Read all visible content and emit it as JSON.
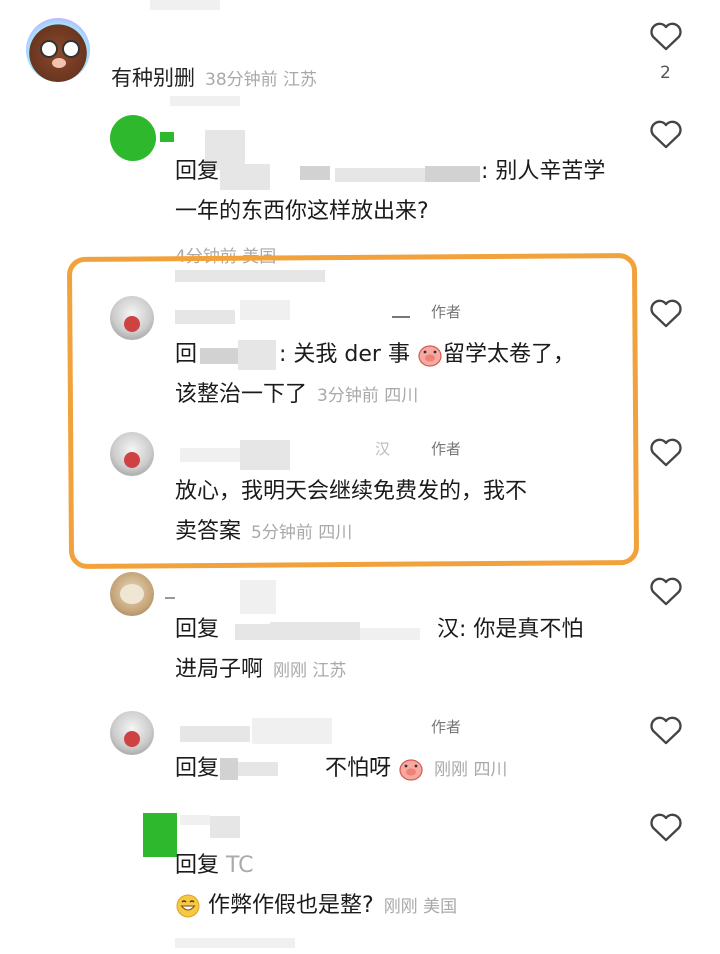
{
  "comments": [
    {
      "name": "有种别删",
      "time": "38分钟前",
      "loc": "江苏",
      "likes": "2"
    },
    {
      "reply_prefix": "回复",
      "line1": ": 别人辛苦学",
      "line2": "一年的东西你这样放出来?",
      "time": "4分钟前",
      "loc": "美国"
    },
    {
      "author_tag": "作者",
      "reply_prefix": "回",
      "line1": ": 关我 der 事",
      "line1b": "留学太卷了，",
      "line2": "该整治一下了",
      "time": "3分钟前",
      "loc": "四川"
    },
    {
      "author_tag": "作者",
      "line1": "放心，我明天会继续免费发的，我不",
      "line2": "卖答案",
      "time": "5分钟前",
      "loc": "四川"
    },
    {
      "reply_prefix": "回复",
      "line1": "汉: 你是真不怕",
      "line2": "进局子啊",
      "time": "刚刚",
      "loc": "江苏"
    },
    {
      "author_tag": "作者",
      "reply_prefix": "回复",
      "line1": "不怕呀",
      "time": "刚刚",
      "loc": "四川"
    },
    {
      "reply_prefix": "回复",
      "reply_partial": "TC",
      "line2": "作弊作假也是整?",
      "time": "刚刚",
      "loc": "美国"
    }
  ],
  "icons": {
    "like": "heart-outline-icon",
    "emoji_pig": "pig-face-emoji",
    "emoji_grin": "grinning-face-emoji"
  },
  "colors": {
    "highlight_border": "#f2a23c",
    "meta_gray": "#a9a9a9",
    "green_avatar": "#2eb82e"
  }
}
